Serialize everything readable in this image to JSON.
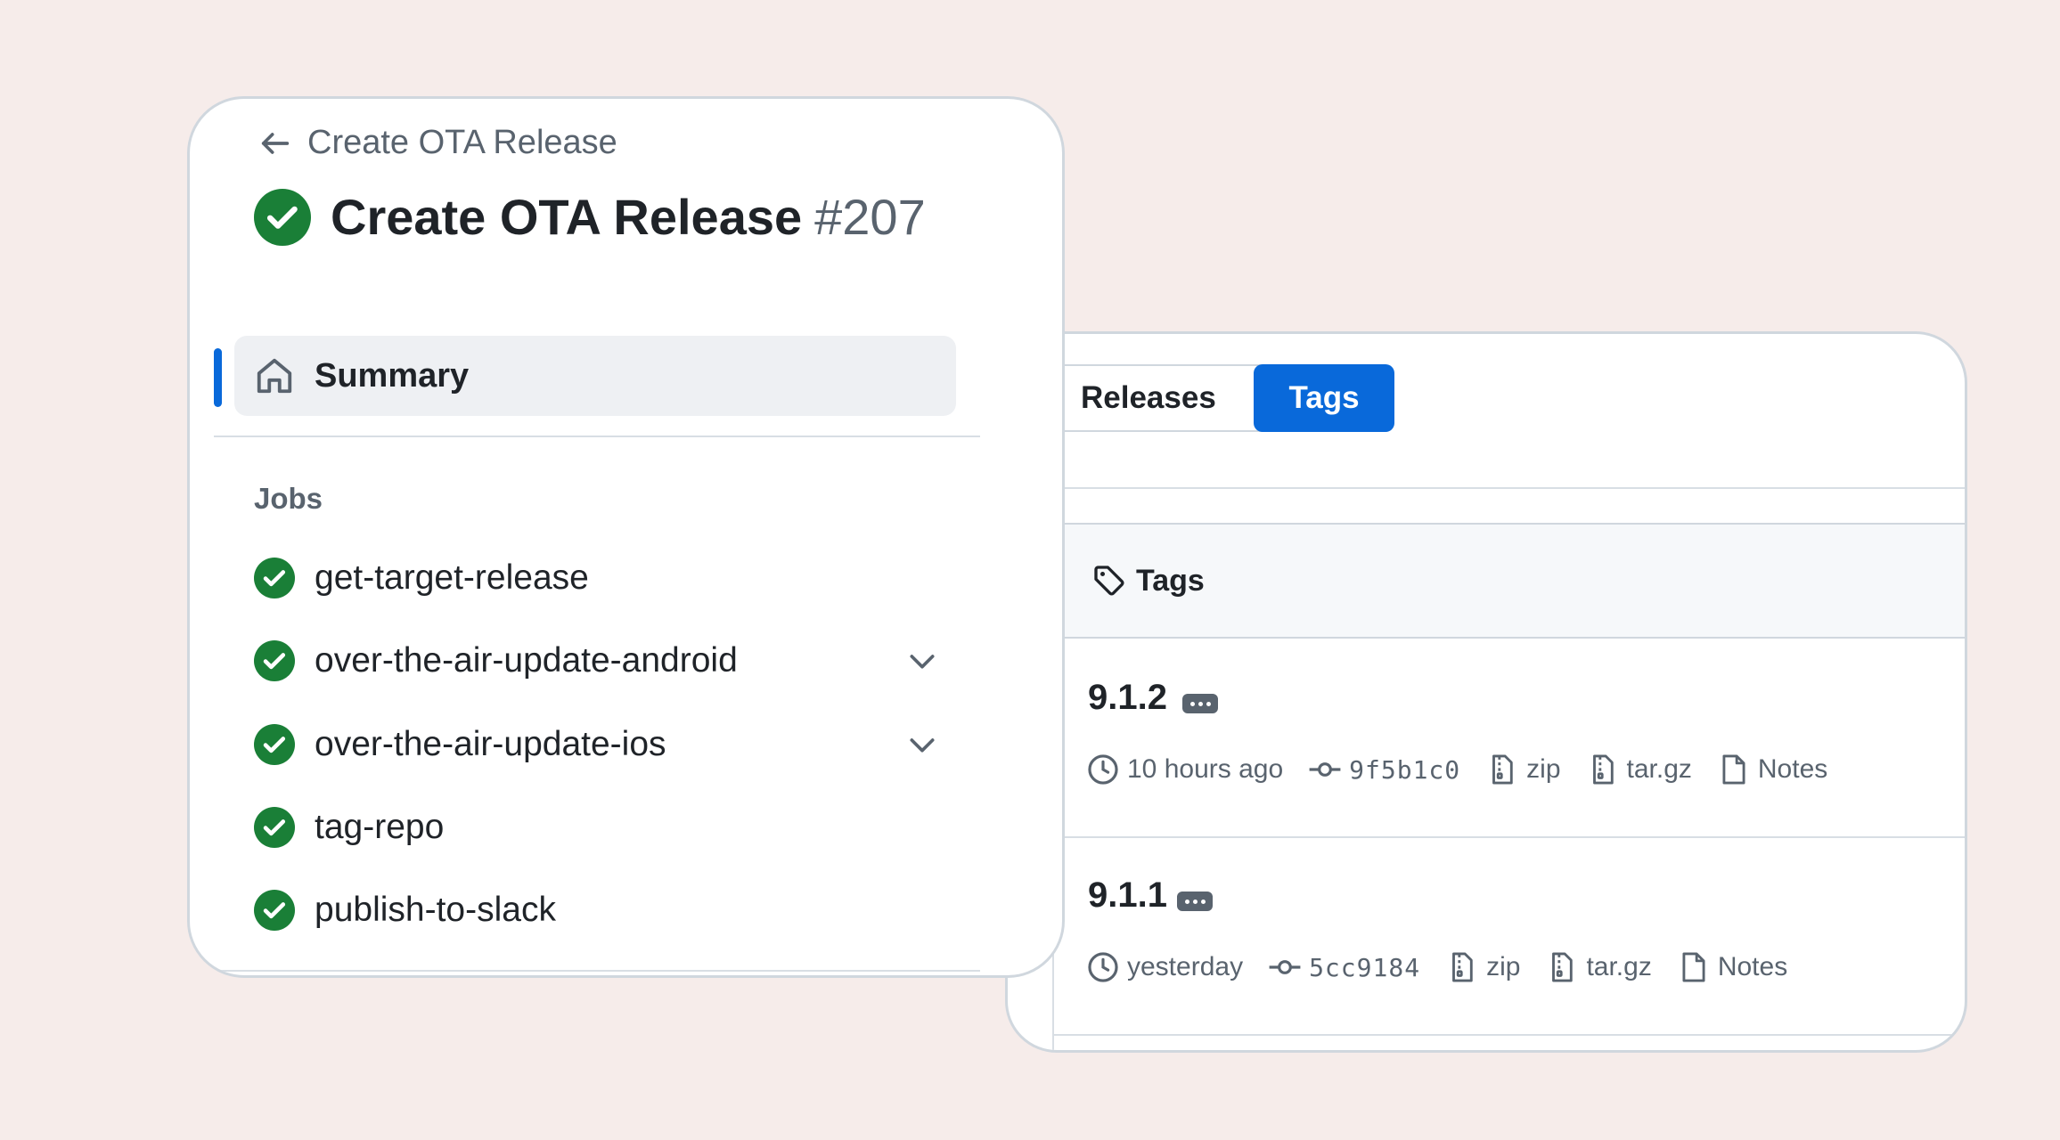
{
  "workflow_run": {
    "back_label": "Create OTA Release",
    "title": "Create OTA Release",
    "run_number": "#207",
    "status": "success",
    "summary_label": "Summary",
    "jobs_heading": "Jobs",
    "jobs": [
      {
        "name": "get-target-release",
        "status": "success",
        "expandable": false
      },
      {
        "name": "over-the-air-update-android",
        "status": "success",
        "expandable": true
      },
      {
        "name": "over-the-air-update-ios",
        "status": "success",
        "expandable": true
      },
      {
        "name": "tag-repo",
        "status": "success",
        "expandable": false
      },
      {
        "name": "publish-to-slack",
        "status": "success",
        "expandable": false
      }
    ]
  },
  "releases_panel": {
    "tabs": [
      {
        "label": "Releases",
        "active": false
      },
      {
        "label": "Tags",
        "active": true
      }
    ],
    "section_title": "Tags",
    "tags": [
      {
        "name": "9.1.2",
        "time": "10 hours ago",
        "commit": "9f5b1c0",
        "zip_label": "zip",
        "targz_label": "tar.gz",
        "notes_label": "Notes"
      },
      {
        "name": "9.1.1",
        "time": "yesterday",
        "commit": "5cc9184",
        "zip_label": "zip",
        "targz_label": "tar.gz",
        "notes_label": "Notes"
      }
    ]
  },
  "icons": {
    "back": "arrow-left-icon",
    "status": "check-circle-icon",
    "summary": "home-icon",
    "expand": "chevron-down-icon",
    "section": "tag-icon",
    "more": "kebab-horizontal-icon",
    "time": "clock-icon",
    "commit": "git-commit-icon",
    "archive": "file-zip-icon",
    "notes": "file-icon"
  },
  "colors": {
    "background": "#f6ecea",
    "success": "#1a7f37",
    "accent": "#0969da",
    "muted_text": "#59636e",
    "text": "#1f2328"
  }
}
